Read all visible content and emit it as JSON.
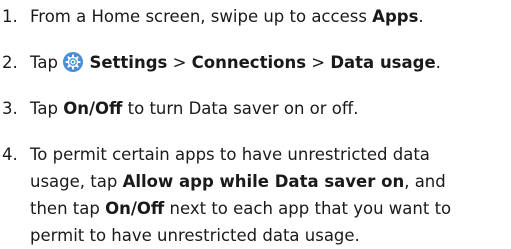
{
  "steps": [
    {
      "number": "1.",
      "lines": [
        [
          {
            "t": "From a Home screen, swipe up to access "
          },
          {
            "t": "Apps",
            "b": true
          },
          {
            "t": "."
          }
        ]
      ]
    },
    {
      "number": "2.",
      "icon": "settings-gear-icon",
      "lines": [
        [
          {
            "t": "Tap "
          },
          {
            "icon": "settings-gear-icon"
          },
          {
            "t": " "
          },
          {
            "t": "Settings",
            "b": true
          },
          {
            "t": " > "
          },
          {
            "t": "Connections",
            "b": true
          },
          {
            "t": " > "
          },
          {
            "t": "Data usage",
            "b": true
          },
          {
            "t": "."
          }
        ]
      ]
    },
    {
      "number": "3.",
      "lines": [
        [
          {
            "t": "Tap "
          },
          {
            "t": "On/Off",
            "b": true
          },
          {
            "t": " to turn Data saver on or off."
          }
        ]
      ]
    },
    {
      "number": "4.",
      "lines": [
        [
          {
            "t": "To permit certain apps to have unrestricted data"
          }
        ],
        [
          {
            "t": "usage, tap "
          },
          {
            "t": "Allow app while Data saver on",
            "b": true
          },
          {
            "t": ", and"
          }
        ],
        [
          {
            "t": "then tap "
          },
          {
            "t": "On/Off",
            "b": true
          },
          {
            "t": " next to each app that you want to"
          }
        ],
        [
          {
            "t": "permit to have unrestricted data usage."
          }
        ]
      ]
    }
  ],
  "colors": {
    "text": "#1a1a1a",
    "icon_bg": "#4a8fd6",
    "icon_fg": "#ffffff"
  }
}
